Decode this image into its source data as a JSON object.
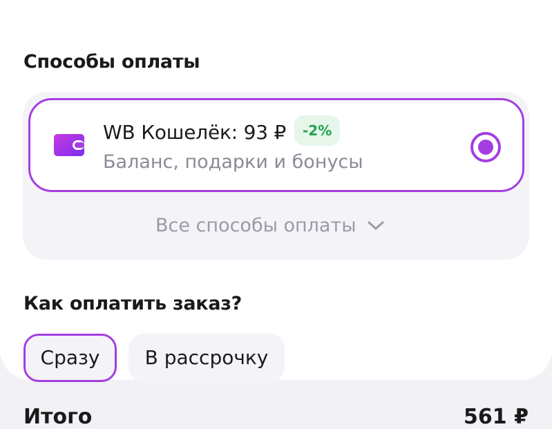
{
  "payment_section": {
    "title": "Способы оплаты",
    "selected_method": {
      "name": "WB Кошелёк: 93 ₽",
      "discount": "-2%",
      "description": "Баланс, подарки и бонусы",
      "icon": "wallet-icon",
      "selected": true
    },
    "all_methods_label": "Все способы оплаты"
  },
  "how_to_pay": {
    "title": "Как оплатить заказ?",
    "options": [
      {
        "label": "Сразу",
        "selected": true
      },
      {
        "label": "В рассрочку",
        "selected": false
      }
    ]
  },
  "summary": {
    "total_label": "Итого",
    "total_value": "561 ₽"
  },
  "colors": {
    "accent": "#a43ee0",
    "discount_text": "#22a355",
    "discount_bg": "#e6f6ea",
    "muted_text": "#8c8996",
    "page_bg": "#f2f1f6"
  }
}
